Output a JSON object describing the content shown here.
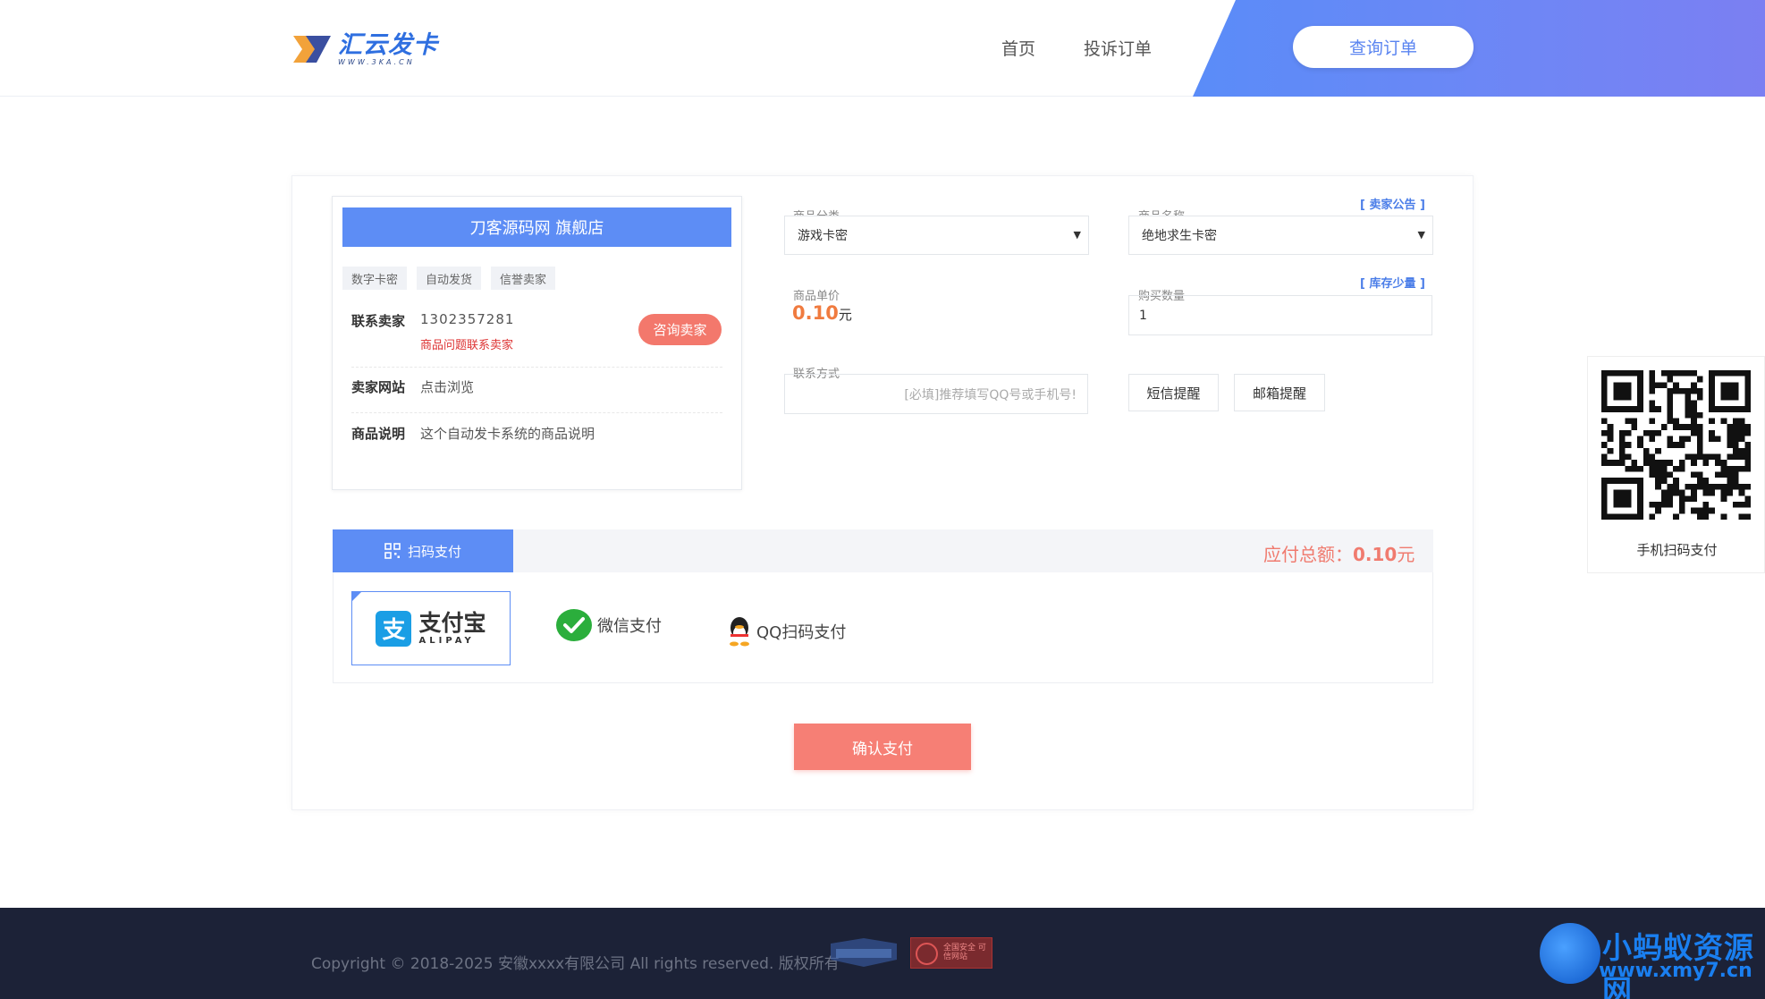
{
  "header": {
    "logo_title": "汇云发卡",
    "logo_sub": "WWW.3KA.CN",
    "nav": [
      "首页",
      "投诉订单"
    ],
    "query_button": "查询订单"
  },
  "shop": {
    "title": "刀客源码网 旗舰店",
    "tags": [
      "数字卡密",
      "自动发货",
      "信誉卖家"
    ],
    "contact_label": "联系卖家",
    "contact_phone": "1302357281",
    "contact_warning": "商品问题联系卖家",
    "consult_button": "咨询卖家",
    "site_label": "卖家网站",
    "site_link": "点击浏览",
    "desc_label": "商品说明",
    "desc_value": "这个自动发卡系统的商品说明"
  },
  "form": {
    "category_label": "商品分类",
    "category_value": "游戏卡密",
    "name_label": "商品名称",
    "name_value": "绝地求生卡密",
    "seller_notice": "[ 卖家公告 ]",
    "price_label": "商品单价",
    "price_value": "0.10",
    "price_unit": "元",
    "stock_notice": "[ 库存少量 ]",
    "qty_label": "购买数量",
    "qty_value": "1",
    "contact_label": "联系方式",
    "contact_placeholder": "[必填]推荐填写QQ号或手机号!",
    "sms_button": "短信提醒",
    "email_button": "邮箱提醒"
  },
  "payment": {
    "tab_label": "扫码支付",
    "total_label": "应付总额：",
    "total_value": "0.10",
    "total_unit": "元",
    "alipay_big": "支付宝",
    "alipay_small": "ALIPAY",
    "wechat_label": "微信支付",
    "qq_label": "QQ扫码支付",
    "confirm_button": "确认支付"
  },
  "qr_side": {
    "caption": "手机扫码支付"
  },
  "footer": {
    "copyright": "Copyright © 2018-2025 安徽xxxx有限公司 All rights reserved. 版权所有",
    "badge2_text": "全国安全 可信网站",
    "watermark_cn": "小蚂蚁资源网",
    "watermark_url": "www.xmy7.cn"
  },
  "colors": {
    "primary": "#5d8df5",
    "accent": "#f67f75",
    "price": "#f07b3f",
    "footer_bg": "#1c2237"
  }
}
